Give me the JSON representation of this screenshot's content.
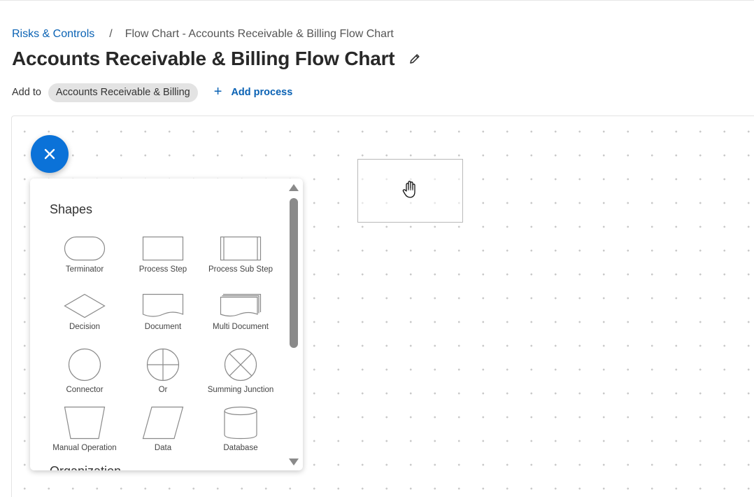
{
  "breadcrumb": {
    "parent": "Risks & Controls",
    "separator": "/",
    "current": "Flow Chart - Accounts Receivable & Billing Flow Chart"
  },
  "page": {
    "title": "Accounts Receivable & Billing Flow Chart",
    "edit_icon": "pencil-icon"
  },
  "add_to": {
    "label": "Add to",
    "chip": "Accounts Receivable & Billing",
    "add_process": "Add process",
    "add_icon": "plus-icon"
  },
  "palette": {
    "toggle_icon": "close-icon",
    "heading": "Shapes",
    "next_heading": "Organization",
    "shapes": [
      {
        "label": "Terminator",
        "icon": "terminator-shape-icon"
      },
      {
        "label": "Process Step",
        "icon": "process-step-shape-icon"
      },
      {
        "label": "Process Sub Step",
        "icon": "process-sub-step-shape-icon"
      },
      {
        "label": "Decision",
        "icon": "decision-shape-icon"
      },
      {
        "label": "Document",
        "icon": "document-shape-icon"
      },
      {
        "label": "Multi Document",
        "icon": "multi-document-shape-icon"
      },
      {
        "label": "Connector",
        "icon": "connector-shape-icon"
      },
      {
        "label": "Or",
        "icon": "or-shape-icon"
      },
      {
        "label": "Summing Junction",
        "icon": "summing-junction-shape-icon"
      },
      {
        "label": "Manual Operation",
        "icon": "manual-operation-shape-icon"
      },
      {
        "label": "Data",
        "icon": "data-shape-icon"
      },
      {
        "label": "Database",
        "icon": "database-shape-icon"
      }
    ]
  },
  "colors": {
    "link": "#0a62b4",
    "fab": "#0b72d8",
    "chip_bg": "#e3e3e3",
    "shape_stroke": "#8a8a8a"
  }
}
